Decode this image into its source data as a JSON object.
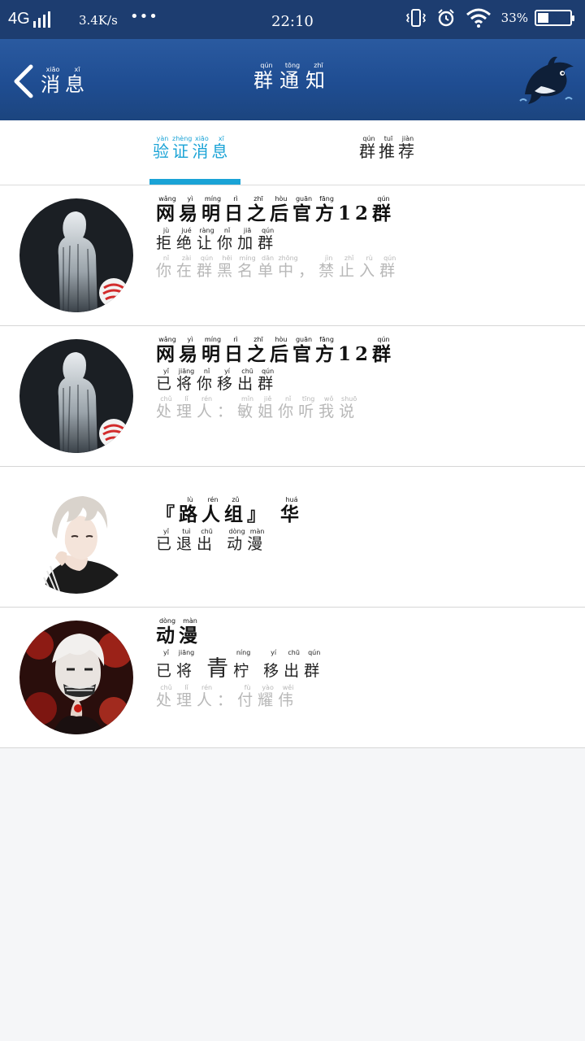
{
  "status_bar": {
    "network": "4G",
    "speed": "3.4K/s",
    "dots": "•••",
    "time": "22:10",
    "battery_percent": "33%",
    "battery_level": 0.33
  },
  "header": {
    "back_label": "消息",
    "back_pinyin": [
      "xiāo",
      "xī"
    ],
    "title": "群通知",
    "title_pinyin": [
      "qún",
      "tōng",
      "zhī"
    ]
  },
  "tabs": [
    {
      "label": "验证消息",
      "pinyin": [
        "yàn",
        "zhèng",
        "xiāo",
        "xī"
      ],
      "active": true
    },
    {
      "label": "群推荐",
      "pinyin": [
        "qún",
        "tuī",
        "jiàn"
      ],
      "active": false
    }
  ],
  "notifications": [
    {
      "title": "网易明日之后官方12群",
      "action": "拒绝让你加群",
      "sub": "你在群黑名单中，禁止入群"
    },
    {
      "title": "网易明日之后官方12群",
      "action": "已将你移出群",
      "sub": "处理人：敏姐你听我说"
    },
    {
      "title": "『路人组』 华",
      "action": "已退出 动漫",
      "sub": ""
    },
    {
      "title": "动漫",
      "action": "已将 青柠 移出群",
      "sub": "处理人：付耀伟"
    }
  ],
  "colors": {
    "header_bg": "#1f4d92",
    "status_bg": "#1d3d70",
    "accent": "#1aa3d6",
    "sub_text": "#b8b8b8"
  }
}
